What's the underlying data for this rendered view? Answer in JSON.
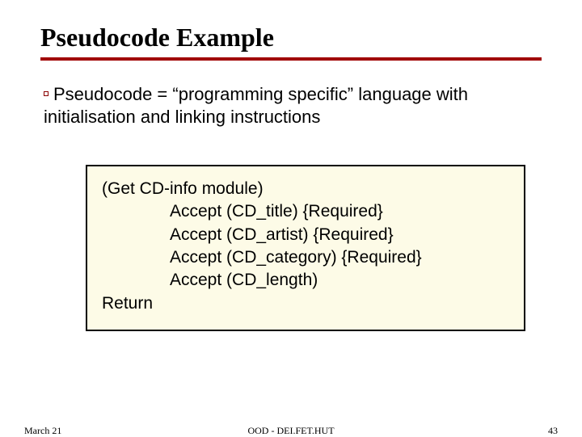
{
  "title": "Pseudocode Example",
  "body": "Pseudocode = “programming specific” language with initialisation and linking instructions",
  "code": {
    "l1": "(Get CD-info module)",
    "l2": "Accept (CD_title) {Required}",
    "l3": "Accept (CD_artist) {Required}",
    "l4": "Accept (CD_category) {Required}",
    "l5": "Accept (CD_length)",
    "l6": "Return"
  },
  "footer": {
    "left": "March 21",
    "center": "OOD - DEI.FET.HUT",
    "right": "43"
  }
}
